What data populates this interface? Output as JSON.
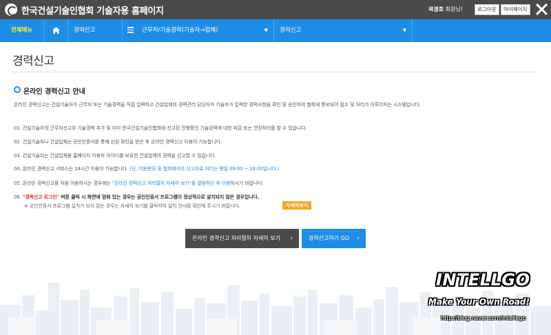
{
  "header": {
    "site_title": "한국건설기술인협회 기술자용 홈페이지",
    "user_name": "곽경호",
    "user_suffix": " 회원님!",
    "logout_label": "로그아웃",
    "mypage_label": "마이페이지"
  },
  "nav": {
    "all_menu": "전체메뉴",
    "menu1": "경력신고",
    "menu2": "근무처/기술경력(기술자→업체)",
    "menu3": "경력신고"
  },
  "main": {
    "page_title": "경력신고",
    "section_title": "온라인 경력신고 안내",
    "intro": "온라인 경력신고는 건설기술자가 근무처 또는 기술경력을 직접 입력하고 건설업체의 경력관리 담당자가 기술자가 입력한 경력사항을 확인 및 승인하여 협회에 통보되어 접수 및 처리가 이루어지는 시스템입니다.",
    "item1": "01. 건설기술자의 근무처신고와 기술경력 추가 및 이미 한국건설기술인협회에 신고된 진행중인 기술경력에 대한 마감 또는 연장처리를 할 수 있습니다.",
    "item2": "02. 건설기술자나 건설업체는 공인인증서를 통해 신원 확인을 받은 후 온라인 경력신고 이용이 가능합니다.",
    "item3": "03. 건설기술자는 건설업체용 홈페이지 이용자 아이디를 보유한 건설업체의 경력을 신고할 수 있습니다.",
    "item4_a": "04. 온라인 경력신고 서비스는 24시간 이용이 가능합니다. ",
    "item4_b": "(단, 이용문의 및 협회에서의 신고자료 처리는 평일 09:00 ~ 18:00입니다.)",
    "item5_a": "05. 온라인 경력신고를 처음 이용하시는 경우에는 ",
    "item5_b": "\"온라인 경력신고 처리절차 자세히 보기\"를 열람하신 후 이용",
    "item5_c": "하시기 바랍니다.",
    "item6_a": "06. ",
    "item6_b": "\"경력신고 로그인\"",
    "item6_c": " 버튼 클릭 시 화면에 멈춰 있는 경우는 공인인증서 프로그램이 정상적으로 설치되지 않은 경우입니다.",
    "item6_note": "※ 공인인증서 프로그램 설치가 되지 않는 경우는 자세히 보기를 클릭하여 설치 안내를 확인해 주시기 바랍니다.",
    "detail_button": "자세히보기",
    "cta_process": "온라인 경력신고 처리절차 자세히 보기",
    "cta_go": "경력신고하기 GO"
  },
  "watermark": {
    "brand": "INTELLGO",
    "slogan": "Make Your Own Road!",
    "url": "http://blog.naver.com/intellego"
  },
  "colors": {
    "topbar": "#4a4a4a",
    "nav_blue": "#1d8de6",
    "accent_yellow": "#ffeb3b",
    "highlight_red": "#d32f2f",
    "badge_orange": "#f5a623"
  }
}
